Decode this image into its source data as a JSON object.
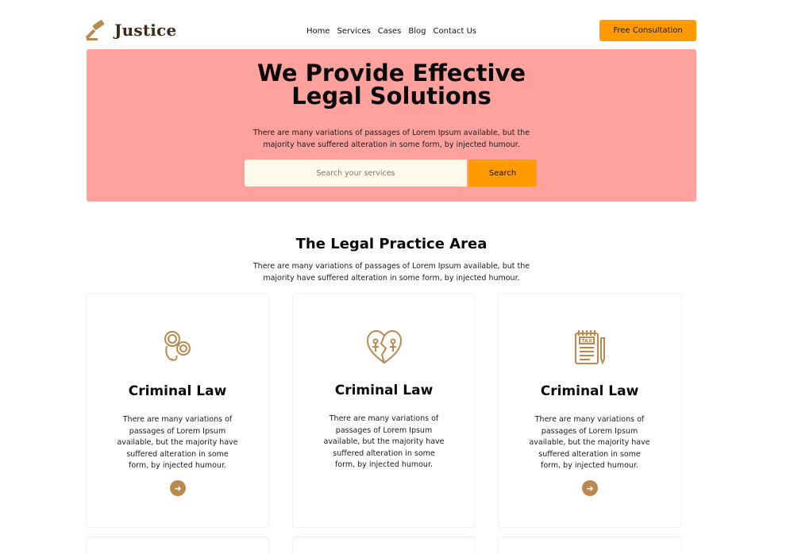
{
  "header": {
    "brand": "Justice",
    "nav": [
      "Home",
      "Services",
      "Cases",
      "Blog",
      "Contact Us"
    ],
    "cta_label": "Free Consultation"
  },
  "hero": {
    "title": "We Provide Effective Legal Solutions",
    "subtitle": "There are many variations of passages of Lorem Ipsum available, but the majority have suffered alteration in some form, by injected humour.",
    "search_placeholder": "Search your services",
    "search_button": "Search",
    "background_color": "#ffa19d"
  },
  "practice": {
    "title": "The Legal Practice Area",
    "subtitle": "There are many variations of passages of Lorem Ipsum available, but the majority have suffered alteration in some form, by injected humour.",
    "cards": [
      {
        "icon": "handcuffs-icon",
        "title": "Criminal Law",
        "text": "There are many variations of passages of Lorem Ipsum available, but the majority have suffered alteration in some form, by injected humour.",
        "arrow": "➜"
      },
      {
        "icon": "broken-heart-icon",
        "title": "Criminal Law",
        "text": "There are many variations of passages of Lorem Ipsum available, but the majority have suffered alteration in some form, by injected humour."
      },
      {
        "icon": "tax-document-icon",
        "title": "Criminal Law",
        "text": "There are many variations of passages of Lorem Ipsum available, but the majority have suffered alteration in some form, by injected humour.",
        "arrow": "➜"
      }
    ]
  },
  "colors": {
    "accent": "#ff9a00",
    "icon_brown": "#b88a4f"
  }
}
